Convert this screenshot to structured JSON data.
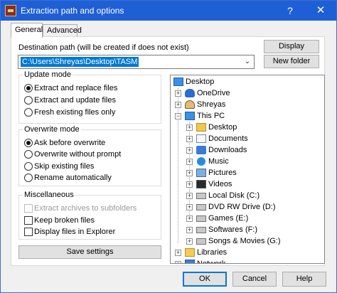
{
  "window": {
    "title": "Extraction path and options",
    "help_glyph": "?",
    "close_glyph": "✕"
  },
  "tabs": [
    {
      "label": "General",
      "active": true
    },
    {
      "label": "Advanced",
      "active": false
    }
  ],
  "destination": {
    "label": "Destination path (will be created if does not exist)",
    "value": "C:\\Users\\Shreyas\\Desktop\\TASM",
    "arrow_glyph": "⌄"
  },
  "buttons": {
    "display": "Display",
    "new_folder": "New folder",
    "save_settings": "Save settings",
    "ok": "OK",
    "cancel": "Cancel",
    "help": "Help"
  },
  "update_mode": {
    "title": "Update mode",
    "options": [
      {
        "label": "Extract and replace files",
        "selected": true
      },
      {
        "label": "Extract and update files",
        "selected": false
      },
      {
        "label": "Fresh existing files only",
        "selected": false
      }
    ]
  },
  "overwrite_mode": {
    "title": "Overwrite mode",
    "options": [
      {
        "label": "Ask before overwrite",
        "selected": true
      },
      {
        "label": "Overwrite without prompt",
        "selected": false
      },
      {
        "label": "Skip existing files",
        "selected": false
      },
      {
        "label": "Rename automatically",
        "selected": false
      }
    ]
  },
  "misc": {
    "title": "Miscellaneous",
    "options": [
      {
        "label": "Extract archives to subfolders",
        "checked": false,
        "disabled": true
      },
      {
        "label": "Keep broken files",
        "checked": false,
        "disabled": false
      },
      {
        "label": "Display files in Explorer",
        "checked": false,
        "disabled": false
      }
    ]
  },
  "tree": {
    "expand_glyph": "+",
    "collapse_glyph": "−",
    "root": "Desktop",
    "level1": [
      {
        "label": "OneDrive",
        "icon": "cloud-icon"
      },
      {
        "label": "Shreyas",
        "icon": "user-icon"
      },
      {
        "label": "This PC",
        "icon": "monitor-icon"
      }
    ],
    "this_pc_children": [
      {
        "label": "Desktop",
        "icon": "folder-icon"
      },
      {
        "label": "Documents",
        "icon": "documents-icon"
      },
      {
        "label": "Downloads",
        "icon": "downloads-icon"
      },
      {
        "label": "Music",
        "icon": "music-icon"
      },
      {
        "label": "Pictures",
        "icon": "pictures-icon"
      },
      {
        "label": "Videos",
        "icon": "videos-icon"
      },
      {
        "label": "Local Disk (C:)",
        "icon": "disk-icon"
      },
      {
        "label": "DVD RW Drive (D:)",
        "icon": "disk-icon"
      },
      {
        "label": "Games (E:)",
        "icon": "disk-icon"
      },
      {
        "label": "Softwares (F:)",
        "icon": "disk-icon"
      },
      {
        "label": "Songs & Movies (G:)",
        "icon": "disk-icon"
      }
    ],
    "level1_tail": [
      {
        "label": "Libraries",
        "icon": "libraries-icon"
      },
      {
        "label": "Network",
        "icon": "network-icon"
      }
    ]
  }
}
